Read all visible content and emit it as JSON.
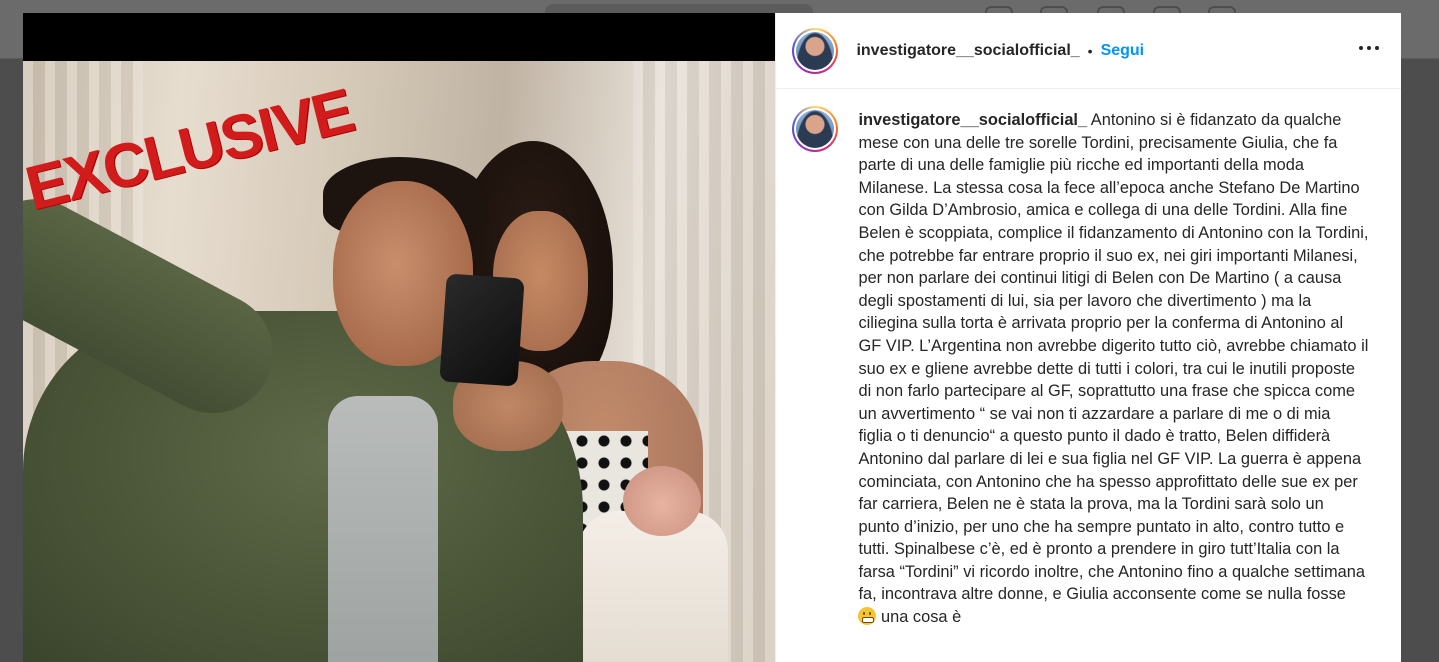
{
  "post": {
    "username": "investigatore__socialofficial_",
    "separator": "•",
    "follow_label": "Segui",
    "stamp_text": "EXCLUSIVE",
    "caption_username": "investigatore__socialofficial_",
    "caption_text": "Antonino si è fidanzato da qualche mese con una delle tre sorelle Tordini, precisamente Giulia, che fa parte di una delle famiglie più ricche ed importanti della moda Milanese. La stessa cosa la fece all’epoca anche Stefano De Martino con Gilda D’Ambrosio, amica e collega di una delle Tordini. Alla fine Belen è scoppiata, complice il fidanzamento di Antonino con la Tordini, che potrebbe far entrare proprio il suo ex, nei giri importanti Milanesi, per non parlare dei continui litigi di Belen con De Martino ( a causa degli spostamenti di lui, sia per lavoro che divertimento ) ma la ciliegina sulla torta è arrivata proprio per la conferma di Antonino al GF VIP. L’Argentina non avrebbe digerito tutto ciò, avrebbe chiamato il suo ex e gliene avrebbe dette di tutti i colori, tra cui le inutili proposte di non farlo partecipare al GF, soprattutto una frase che spicca come un avvertimento “ se vai non ti azzardare a parlare di me o di mia figlia o ti denuncio“ a questo punto il dado è tratto, Belen diffiderà Antonino dal parlare di lei e sua figlia nel GF VIP. La guerra è appena cominciata, con Antonino che ha spesso approfittato delle sue ex per far carriera, Belen ne è stata la prova, ma la Tordini sarà solo un punto d’inizio, per uno che ha sempre puntato in alto, contro tutto e tutti. Spinalbese c’è, ed è pronto a prendere in giro tutt’Italia con la farsa “Tordini” vi ricordo inoltre, che Antonino fino a qualche settimana fa, incontrava altre donne, e Giulia acconsente come se nulla fosse",
    "caption_tail": "una cosa è",
    "icons": {
      "more": "more-options-icon",
      "emoji": "grimacing-face-emoji"
    },
    "colors": {
      "follow": "#0095f6",
      "stamp": "#d21c1c"
    }
  }
}
